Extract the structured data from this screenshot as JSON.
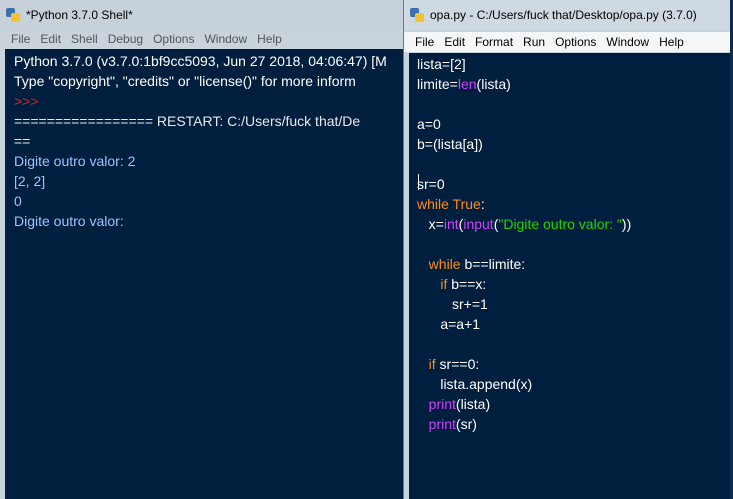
{
  "shell": {
    "title": "*Python 3.7.0 Shell*",
    "menu": [
      "File",
      "Edit",
      "Shell",
      "Debug",
      "Options",
      "Window",
      "Help"
    ],
    "lines": [
      "Python 3.7.0 (v3.7.0:1bf9cc5093, Jun 27 2018, 04:06:47) [M",
      "Type \"copyright\", \"credits\" or \"license()\" for more inform",
      ">>>",
      "================= RESTART: C:/Users/fuck that/De",
      "==",
      "Digite outro valor: 2",
      "[2, 2]",
      "0",
      "Digite outro valor:"
    ]
  },
  "editor": {
    "title": "opa.py - C:/Users/fuck that/Desktop/opa.py (3.7.0)",
    "menu": [
      "File",
      "Edit",
      "Format",
      "Run",
      "Options",
      "Window",
      "Help"
    ],
    "code": {
      "l1": "lista=[2]",
      "l2_a": "limite=",
      "l2_b": "len",
      "l2_c": "(lista)",
      "l3": "a=0",
      "l4": "b=(lista[a])",
      "l5": "sr=0",
      "l6_a": "while",
      "l6_b": " True",
      "l6_c": ":",
      "l7_a": "   x=",
      "l7_b": "int",
      "l7_c": "(",
      "l7_d": "input",
      "l7_e": "(",
      "l7_f": "\"Digite outro valor: \"",
      "l7_g": "))",
      "l8_a": "   ",
      "l8_b": "while",
      "l8_c": " b==limite:",
      "l9_a": "      ",
      "l9_b": "if",
      "l9_c": " b==x:",
      "l10": "         sr+=1",
      "l11": "      a=a+1",
      "l12_a": "   ",
      "l12_b": "if",
      "l12_c": " sr==0:",
      "l13": "      lista.append(x)",
      "l14_a": "   ",
      "l14_b": "print",
      "l14_c": "(lista)",
      "l15_a": "   ",
      "l15_b": "print",
      "l15_c": "(sr)"
    }
  }
}
